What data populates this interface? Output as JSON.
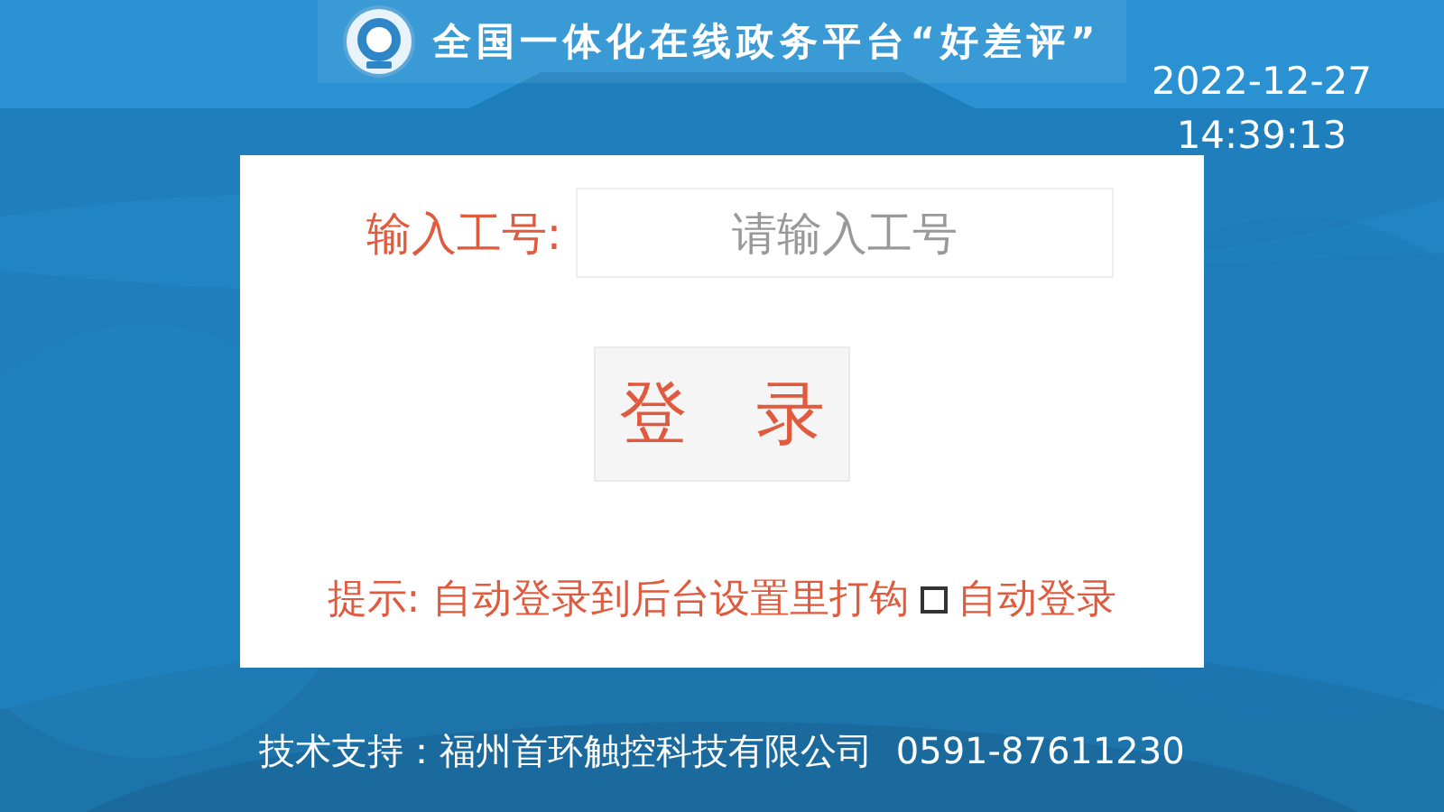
{
  "header": {
    "title": "全国一体化在线政务平台“好差评”"
  },
  "clock": {
    "date": "2022-12-27",
    "time": "14:39:13"
  },
  "login": {
    "label": "输入工号:",
    "input": {
      "placeholder": "请输入工号"
    },
    "button": "登　录",
    "hint": "提示: 自动登录到后台设置里打钩",
    "auto_login": {
      "label": "自动登录",
      "checked": false
    }
  },
  "footer": {
    "support": "技术支持：福州首环触控科技有限公司  0591-87611230"
  }
}
